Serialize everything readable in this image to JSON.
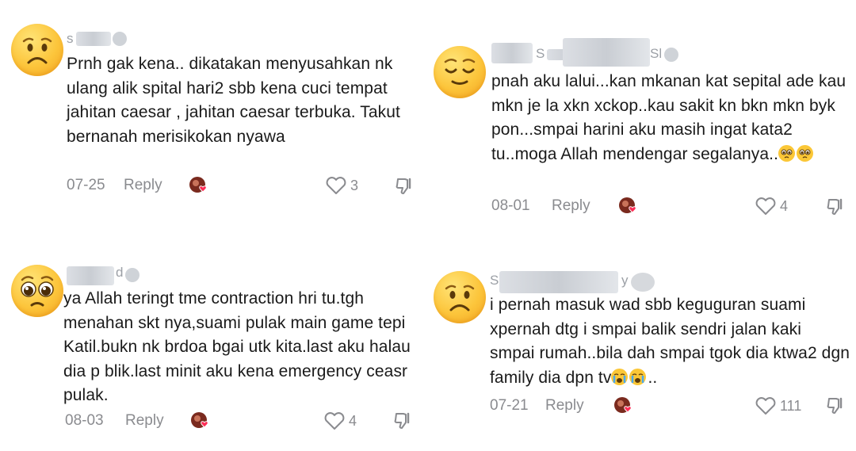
{
  "comments": [
    {
      "avatar_icon": "worried-face-icon",
      "username_visible": "s",
      "text": "Prnh gak kena.. dikatakan menyusahkan nk ulang alik spital hari2 sbb kena cuci tempat jahitan caesar , jahitan caesar terbuka. Takut bernanah merisikokan nyawa",
      "date": "07-25",
      "reply_label": "Reply",
      "likes": "3"
    },
    {
      "avatar_icon": "relieved-face-icon",
      "username_visible": [
        "S",
        "Sl"
      ],
      "text": "pnah aku lalui...kan mkanan kat sepital ade kau mkn je la xkn xckop..kau sakit kn bkn mkn byk pon...smpai harini aku masih ingat kata2 tu..moga Allah mendengar segalanya..",
      "emoji_suffix": [
        "pleading-face-icon",
        "pleading-face-icon"
      ],
      "date": "08-01",
      "reply_label": "Reply",
      "likes": "4"
    },
    {
      "avatar_icon": "pleading-face-icon",
      "username_visible": "d",
      "text": "ya Allah teringt tme contraction hri tu.tgh menahan skt nya,suami pulak main game tepi Katil.bukn nk brdoa bgai utk kita.last aku halau dia p blik.last minit aku kena emergency ceasr pulak.",
      "date": "08-03",
      "reply_label": "Reply",
      "likes": "4"
    },
    {
      "avatar_icon": "worried-face-icon",
      "username_visible": [
        "S",
        "y"
      ],
      "text": "i pernah masuk wad sbb keguguran suami xpernah dtg i smpai balik sendri jalan kaki smpai rumah..bila dah smpai tgok dia ktwa2 dgn family dia dpn tv",
      "emoji_suffix": [
        "crying-face-icon",
        "crying-face-icon"
      ],
      "text_suffix": "..",
      "date": "07-21",
      "reply_label": "Reply",
      "likes": "111"
    }
  ]
}
